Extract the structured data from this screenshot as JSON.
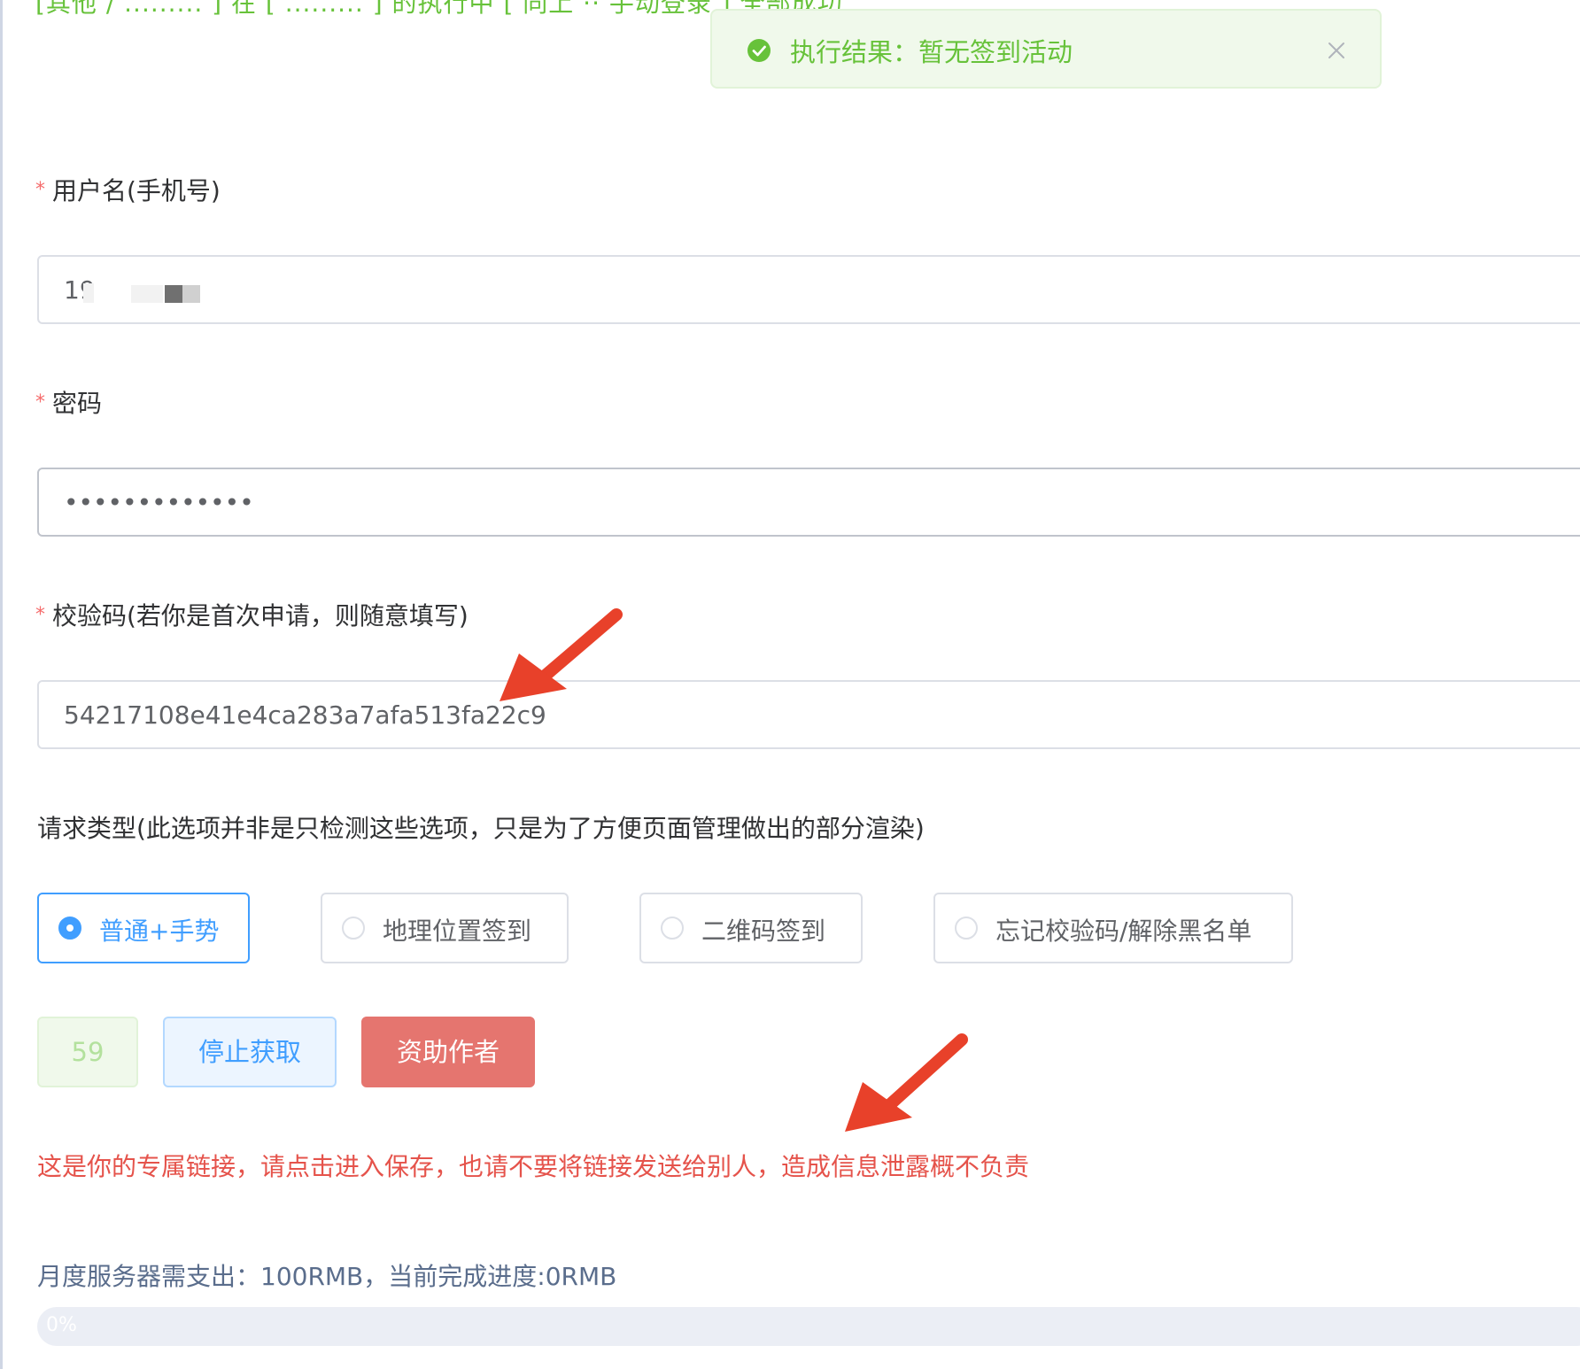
{
  "top_strip": {
    "text": "[其他 / ......... ] 在 [ ......... ] 的执行中 [ 同上 ·· 手动登录 ] 全部成功"
  },
  "toast": {
    "message": "执行结果：暂无签到活动",
    "status_color": "#67c23a"
  },
  "form": {
    "username": {
      "label": "用户名(手机号)",
      "value": "19"
    },
    "password": {
      "label": "密码",
      "value": "•••••••••••••"
    },
    "verify_code": {
      "label": "校验码(若你是首次申请，则随意填写)",
      "value": "54217108e41e4ca283a7afa513fa22c9"
    },
    "request_type": {
      "label": "请求类型(此选项并非是只检测这些选项，只是为了方便页面管理做出的部分渲染)",
      "options": [
        {
          "label": "普通+手势",
          "selected": true
        },
        {
          "label": "地理位置签到",
          "selected": false
        },
        {
          "label": "二维码签到",
          "selected": false
        },
        {
          "label": "忘记校验码/解除黑名单",
          "selected": false
        }
      ]
    }
  },
  "actions": {
    "countdown": "59",
    "stop_label": "停止获取",
    "donate_label": "资助作者"
  },
  "warning": "这是你的专属链接，请点击进入保存，也请不要将链接发送给别人，造成信息泄露概不负责",
  "budget": {
    "text": "月度服务器需支出：100RMB，当前完成进度:0RMB",
    "progress_label": "0%",
    "progress_percent": 0
  },
  "colors": {
    "primary": "#409eff",
    "success": "#67c23a",
    "danger": "#e5756f",
    "annotation_arrow": "#e8412a"
  }
}
